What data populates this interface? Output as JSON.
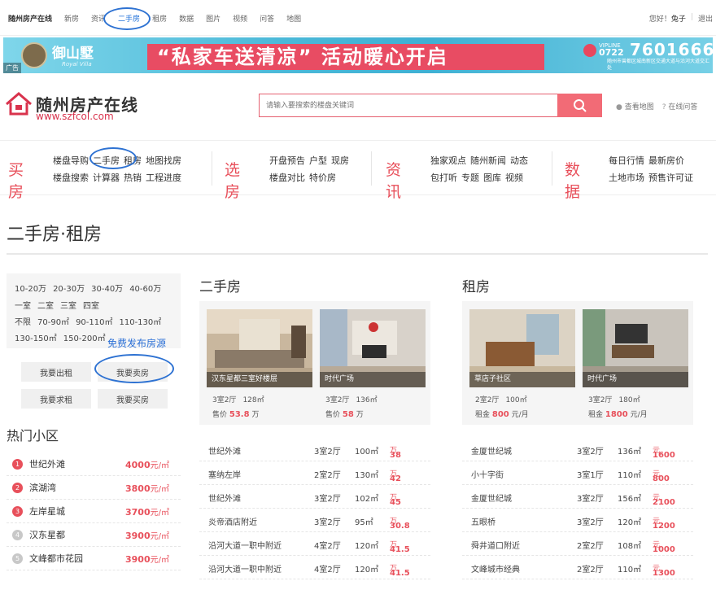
{
  "topbar": {
    "site": "随州房产在线",
    "nav": [
      "新房",
      "资讯",
      "二手房",
      "租房",
      "数据",
      "图片",
      "视频",
      "问答",
      "地图"
    ],
    "greeting": "您好！",
    "username": "兔子",
    "logout": "退出"
  },
  "banner": {
    "ad_tag": "广告",
    "logo_text": "御山墅",
    "logo_sub": "Royal Villa",
    "slogan": "“私家车送清凉” 活动暖心开启",
    "vipline": "VIPLINE",
    "phone_prefix": "0722",
    "phone": "7601666",
    "address": "随州市曾都区城南新区交通大道与沿河大道交汇处"
  },
  "header": {
    "brand": "随州房产在线",
    "domain": "www.szfcol.com",
    "search_placeholder": "请输入要搜索的楼盘关键词",
    "link_map": "查看地图",
    "link_qa": "在线问答"
  },
  "mainnav": {
    "groups": [
      {
        "title": "买房",
        "row1": [
          "楼盘导购",
          "二手房",
          "租房",
          "地图找房"
        ],
        "row2": [
          "楼盘搜索",
          "计算器",
          "热销",
          "工程进度"
        ]
      },
      {
        "title": "选房",
        "row1": [
          "开盘预告",
          "户型",
          "现房"
        ],
        "row2": [
          "楼盘对比",
          "特价房"
        ]
      },
      {
        "title": "资讯",
        "row1": [
          "独家观点",
          "随州新闻",
          "动态"
        ],
        "row2": [
          "包打听",
          "专题",
          "图库",
          "视频"
        ]
      },
      {
        "title": "数据",
        "row1": [
          "每日行情",
          "最新房价"
        ],
        "row2": [
          "土地市场",
          "预售许可证"
        ]
      }
    ]
  },
  "page": {
    "title": "二手房·租房"
  },
  "filter": {
    "row1": [
      "10-20万",
      "20-30万",
      "30-40万",
      "40-60万"
    ],
    "row2": [
      "一室",
      "二室",
      "三室",
      "四室"
    ],
    "row3": [
      "不限",
      "70-90㎡",
      "90-110㎡",
      "110-130㎡"
    ],
    "row4": [
      "130-150㎡",
      "150-200㎡"
    ]
  },
  "publish_label": "免费发布房源",
  "buttons": {
    "rent_out": "我要出租",
    "sell": "我要卖房",
    "rent_in": "我要求租",
    "buy": "我要买房"
  },
  "hot": {
    "title": "热门小区",
    "unit": "元/㎡",
    "items": [
      {
        "num": "1",
        "name": "世纪外滩",
        "price": "4000",
        "color": "#e8505b"
      },
      {
        "num": "2",
        "name": "滨湖湾",
        "price": "3800",
        "color": "#e8505b"
      },
      {
        "num": "3",
        "name": "左岸星城",
        "price": "3700",
        "color": "#e8505b"
      },
      {
        "num": "4",
        "name": "汉东星都",
        "price": "3900",
        "color": "#c8c8c8"
      },
      {
        "num": "5",
        "name": "文峰都市花园",
        "price": "3900",
        "color": "#c8c8c8"
      }
    ]
  },
  "second": {
    "title": "二手房",
    "price_label": "售价",
    "cards": [
      {
        "caption": "汉东星都三室好楼层",
        "rooms": "3室2厅",
        "area": "128㎡",
        "price": "53.8",
        "unit": "万"
      },
      {
        "caption": "时代广场",
        "rooms": "3室2厅",
        "area": "136㎡",
        "price": "58",
        "unit": "万"
      }
    ],
    "rows": [
      {
        "name": "世纪外滩",
        "rooms": "3室2厅",
        "area": "100㎡",
        "price": "38",
        "unit": "万"
      },
      {
        "name": "塞纳左岸",
        "rooms": "2室2厅",
        "area": "130㎡",
        "price": "42",
        "unit": "万"
      },
      {
        "name": "世纪外滩",
        "rooms": "3室2厅",
        "area": "102㎡",
        "price": "45",
        "unit": "万"
      },
      {
        "name": "炎帝酒店附近",
        "rooms": "3室2厅",
        "area": "95㎡",
        "price": "30.8",
        "unit": "万"
      },
      {
        "name": "沿河大道一职中附近",
        "rooms": "4室2厅",
        "area": "120㎡",
        "price": "41.5",
        "unit": "万"
      },
      {
        "name": "沿河大道一职中附近",
        "rooms": "4室2厅",
        "area": "120㎡",
        "price": "41.5",
        "unit": "万"
      }
    ]
  },
  "rent": {
    "title": "租房",
    "price_label": "租金",
    "cards": [
      {
        "caption": "草店子社区",
        "rooms": "2室2厅",
        "area": "100㎡",
        "price": "800",
        "unit": "元/月"
      },
      {
        "caption": "时代广场",
        "rooms": "3室2厅",
        "area": "180㎡",
        "price": "1800",
        "unit": "元/月"
      }
    ],
    "rows": [
      {
        "name": "金厦世纪城",
        "rooms": "3室2厅",
        "area": "136㎡",
        "price": "1600",
        "unit": "元"
      },
      {
        "name": "小十字街",
        "rooms": "3室1厅",
        "area": "110㎡",
        "price": "800",
        "unit": "元"
      },
      {
        "name": "金厦世纪城",
        "rooms": "3室2厅",
        "area": "156㎡",
        "price": "2100",
        "unit": "元"
      },
      {
        "name": "五眼桥",
        "rooms": "3室2厅",
        "area": "120㎡",
        "price": "1200",
        "unit": "元"
      },
      {
        "name": "舜井道口附近",
        "rooms": "2室2厅",
        "area": "108㎡",
        "price": "1000",
        "unit": "元"
      },
      {
        "name": "文峰城市经典",
        "rooms": "2室2厅",
        "area": "110㎡",
        "price": "1300",
        "unit": "元"
      }
    ]
  }
}
